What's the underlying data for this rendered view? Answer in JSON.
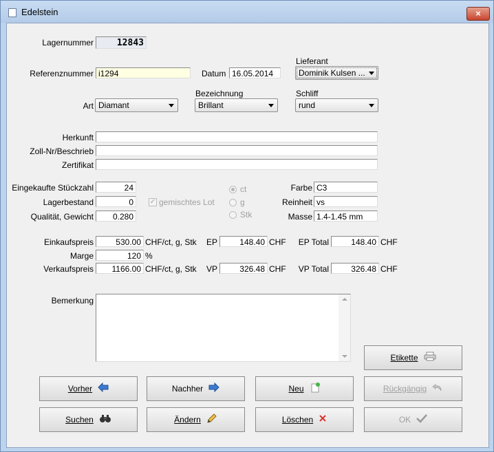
{
  "window": {
    "title": "Edelstein",
    "close_glyph": "×"
  },
  "lagernummer": {
    "label": "Lagernummer",
    "value": "12843"
  },
  "referenznummer": {
    "label": "Referenznummer",
    "value": "i1294"
  },
  "datum": {
    "label": "Datum",
    "value": "16.05.2014"
  },
  "lieferant": {
    "label": "Lieferant",
    "value": "Dominik Kulsen ..."
  },
  "art": {
    "label": "Art",
    "value": "Diamant"
  },
  "bezeichnung": {
    "label": "Bezeichnung",
    "value": "Brillant"
  },
  "schliff": {
    "label": "Schliff",
    "value": "rund"
  },
  "herkunft": {
    "label": "Herkunft",
    "value": ""
  },
  "zoll": {
    "label": "Zoll-Nr/Beschrieb",
    "value": ""
  },
  "zertifikat": {
    "label": "Zertifikat",
    "value": ""
  },
  "stueckzahl": {
    "label": "Eingekaufte Stückzahl",
    "value": "24"
  },
  "lagerbestand": {
    "label": "Lagerbestand",
    "value": "0"
  },
  "qualitaet": {
    "label": "Qualität, Gewicht",
    "value": "0.280"
  },
  "gemischtes_lot": {
    "label": "gemischtes Lot"
  },
  "units": {
    "ct": "ct",
    "g": "g",
    "stk": "Stk",
    "selected": "ct"
  },
  "farbe": {
    "label": "Farbe",
    "value": "C3"
  },
  "reinheit": {
    "label": "Reinheit",
    "value": "vs"
  },
  "masse": {
    "label": "Masse",
    "value": "1.4-1.45 mm"
  },
  "einkaufspreis": {
    "label": "Einkaufspreis",
    "value": "530.00",
    "unit": "CHF/ct, g, Stk"
  },
  "ep": {
    "label": "EP",
    "value": "148.40",
    "currency": "CHF"
  },
  "ep_total": {
    "label": "EP Total",
    "value": "148.40",
    "currency": "CHF"
  },
  "marge": {
    "label": "Marge",
    "value": "120",
    "unit": "%"
  },
  "verkaufspreis": {
    "label": "Verkaufspreis",
    "value": "1166.00",
    "unit": "CHF/ct, g, Stk"
  },
  "vp": {
    "label": "VP",
    "value": "326.48",
    "currency": "CHF"
  },
  "vp_total": {
    "label": "VP Total",
    "value": "326.48",
    "currency": "CHF"
  },
  "bemerkung": {
    "label": "Bemerkung",
    "value": ""
  },
  "buttons": {
    "etikette": "Etikette",
    "vorher": "Vorher",
    "nachher": "Nachher",
    "neu": "Neu",
    "rueckgaengig": "Rückgängig",
    "suchen": "Suchen",
    "aendern": "Ändern",
    "loeschen": "Löschen",
    "ok": "OK"
  },
  "icons": {
    "window": "window-icon",
    "printer": "printer-icon",
    "arrow_left": "arrow-left-icon",
    "arrow_right": "arrow-right-icon",
    "new_document": "new-document-icon",
    "undo": "undo-icon",
    "binoculars": "binoculars-icon",
    "pencil": "pencil-icon",
    "delete": "delete-x-icon",
    "check": "checkmark-icon"
  },
  "colors": {
    "reference_field": "#ffffe1",
    "arrow": "#3b7ad0",
    "delete": "#d9342b",
    "check": "#9a9a9a"
  }
}
